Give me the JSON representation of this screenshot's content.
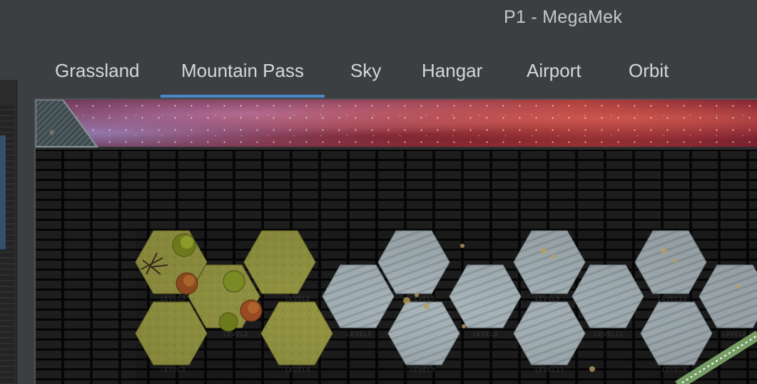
{
  "window": {
    "title": "P1 - MegaMek"
  },
  "tabs": [
    {
      "label": "Grassland",
      "selected": false
    },
    {
      "label": "Mountain Pass",
      "selected": true
    },
    {
      "label": "Sky",
      "selected": false
    },
    {
      "label": "Hangar",
      "selected": false
    },
    {
      "label": "Airport",
      "selected": false
    },
    {
      "label": "Orbit",
      "selected": false
    }
  ],
  "colors": {
    "accent": "#4a88c7",
    "grass": "#9a9a45",
    "rock": "#a9b5ba",
    "background": "#3c3f41"
  },
  "map": {
    "hex_labels": {
      "h1": "LEVEL3",
      "h2": "LEVEL2",
      "h3": "LEVEL5",
      "h4": "LEVEL9",
      "h5": "LEVEL10",
      "h6": "LEVEL2",
      "h7": "LEVEL5",
      "h8": "LEVEL8",
      "h9": "LEVEL11",
      "h10": "LEVEL8",
      "h11": "LEVEL3",
      "h12": "LEVEL4",
      "h13": "LEVEL5",
      "h14": "LEVEL11",
      "h15": "LEVEL8"
    }
  }
}
